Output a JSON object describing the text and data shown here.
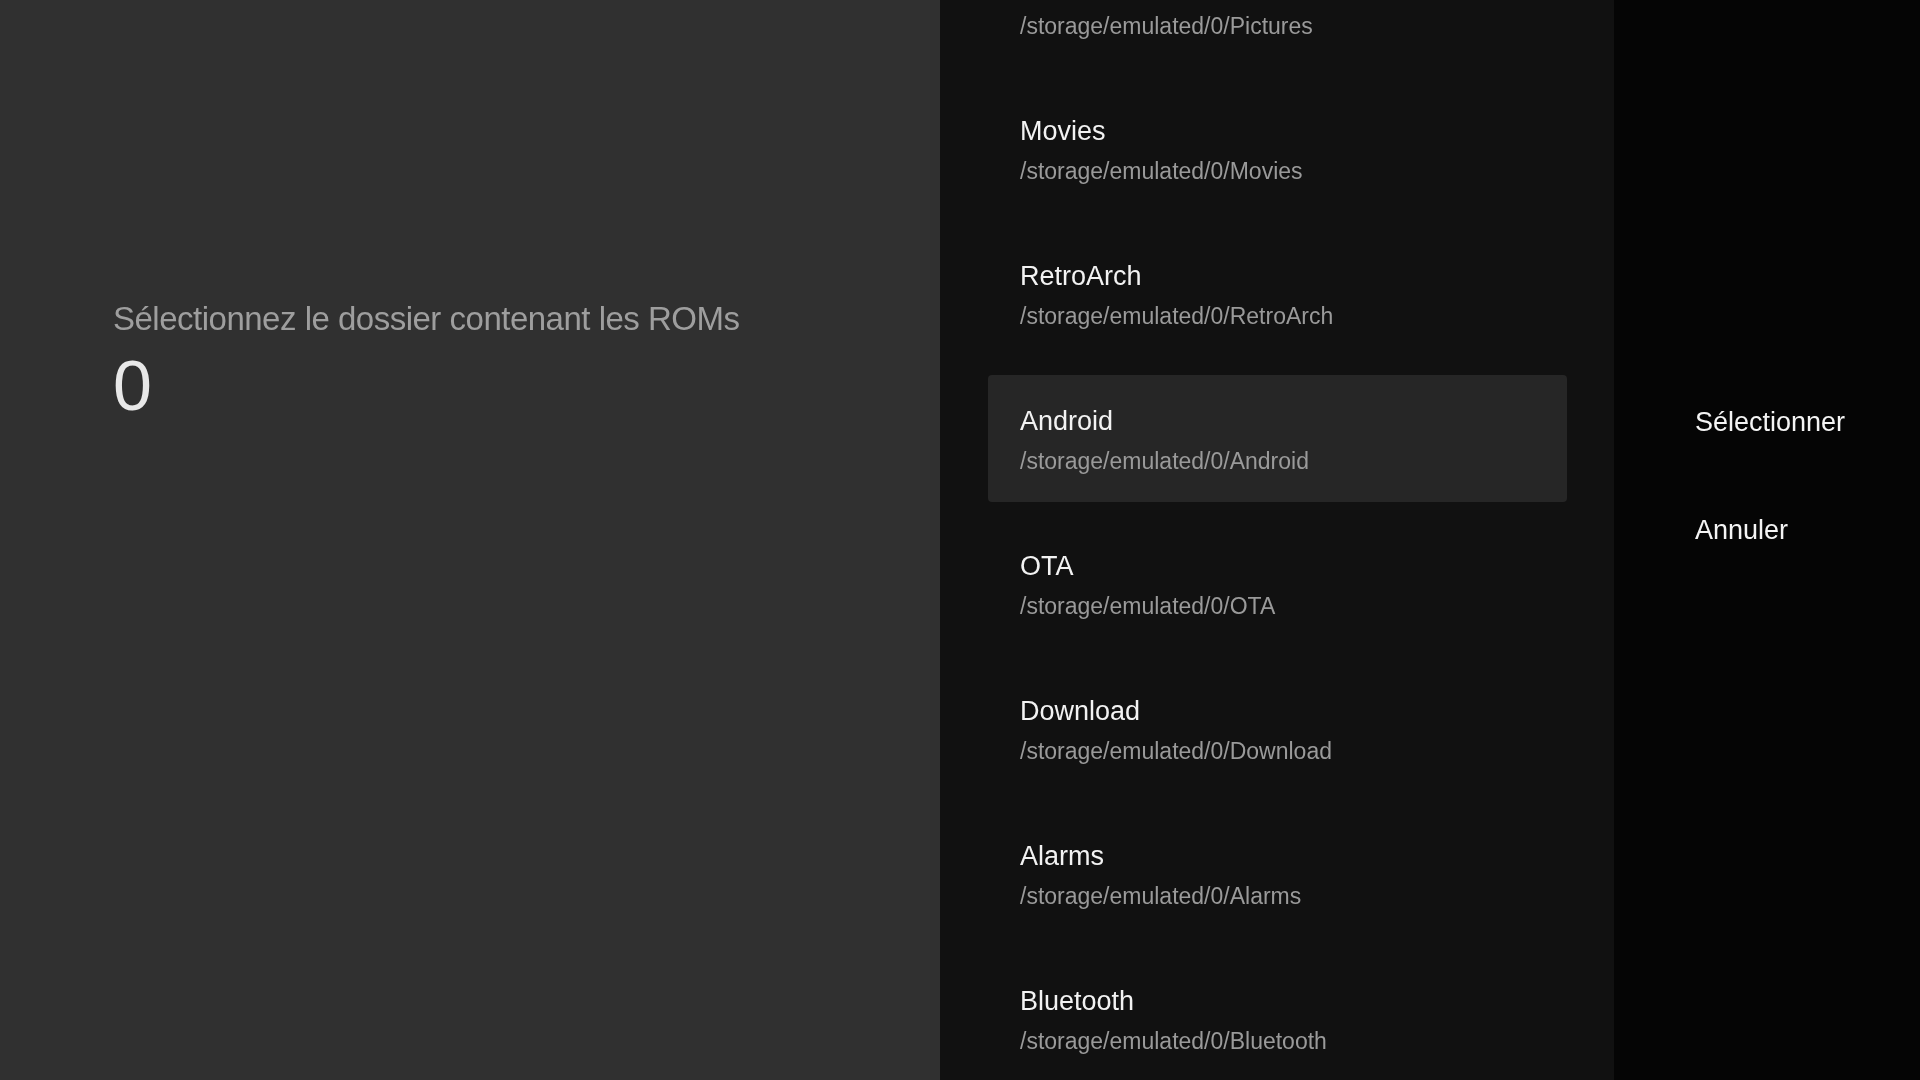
{
  "prompt": {
    "title": "Sélectionnez le dossier contenant les ROMs",
    "count": "0"
  },
  "folders": [
    {
      "path": "/storage/emulated/0/Pictures",
      "selected": false
    },
    {
      "name": "Movies",
      "path": "/storage/emulated/0/Movies",
      "selected": false
    },
    {
      "name": "RetroArch",
      "path": "/storage/emulated/0/RetroArch",
      "selected": false
    },
    {
      "name": "Android",
      "path": "/storage/emulated/0/Android",
      "selected": true
    },
    {
      "name": "OTA",
      "path": "/storage/emulated/0/OTA",
      "selected": false
    },
    {
      "name": "Download",
      "path": "/storage/emulated/0/Download",
      "selected": false
    },
    {
      "name": "Alarms",
      "path": "/storage/emulated/0/Alarms",
      "selected": false
    },
    {
      "name": "Bluetooth",
      "path": "/storage/emulated/0/Bluetooth",
      "selected": false
    }
  ],
  "actions": [
    "Sélectionner",
    "Annuler"
  ]
}
